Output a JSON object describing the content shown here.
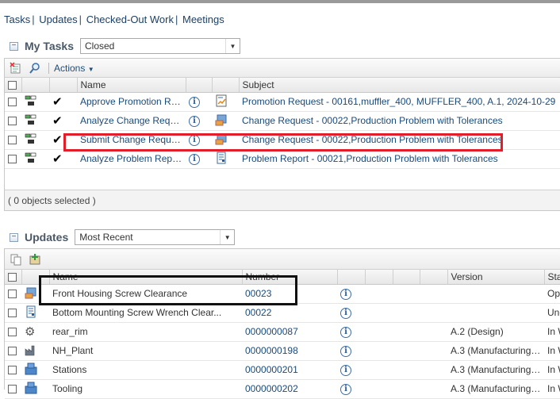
{
  "nav": {
    "items": [
      "Tasks",
      "Updates",
      "Checked-Out Work",
      "Meetings"
    ]
  },
  "my_tasks": {
    "title": "My Tasks",
    "filter": "Closed",
    "toolbar": {
      "actions_label": "Actions"
    },
    "columns": {
      "name": "Name",
      "subject": "Subject"
    },
    "rows": [
      {
        "name": "Approve Promotion Req...",
        "subject": "Promotion Request - 00161,muffler_400, MUFFLER_400, A.1, 2024-10-29"
      },
      {
        "name": "Analyze Change Request",
        "subject": "Change Request - 00022,Production Problem with Tolerances"
      },
      {
        "name": "Submit Change Request",
        "subject": "Change Request - 00022,Production Problem with Tolerances"
      },
      {
        "name": "Analyze Problem Report",
        "subject": "Problem Report - 00021,Production Problem with Tolerances"
      }
    ],
    "footer": "( 0 objects selected )"
  },
  "updates": {
    "title": "Updates",
    "filter": "Most Recent",
    "columns": {
      "name": "Name",
      "number": "Number",
      "version": "Version",
      "state": "Stat"
    },
    "rows": [
      {
        "name": "Front Housing Screw Clearance",
        "number": "00023",
        "version": "",
        "state": "Ope"
      },
      {
        "name": "Bottom Mounting Screw Wrench Clear...",
        "number": "00022",
        "version": "",
        "state": "Und"
      },
      {
        "name": "rear_rim",
        "number": "0000000087",
        "version": "A.2 (Design)",
        "state": "In W"
      },
      {
        "name": "NH_Plant",
        "number": "0000000198",
        "version": "A.3 (Manufacturing) (...",
        "state": "In W"
      },
      {
        "name": "Stations",
        "number": "0000000201",
        "version": "A.3 (Manufacturing) (...",
        "state": "In W"
      },
      {
        "name": "Tooling",
        "number": "0000000202",
        "version": "A.3 (Manufacturing) (...",
        "state": "In W"
      }
    ]
  },
  "colors": {
    "highlight_red": "#e21e2b",
    "highlight_black": "#111111",
    "link": "#1a4a7a"
  }
}
